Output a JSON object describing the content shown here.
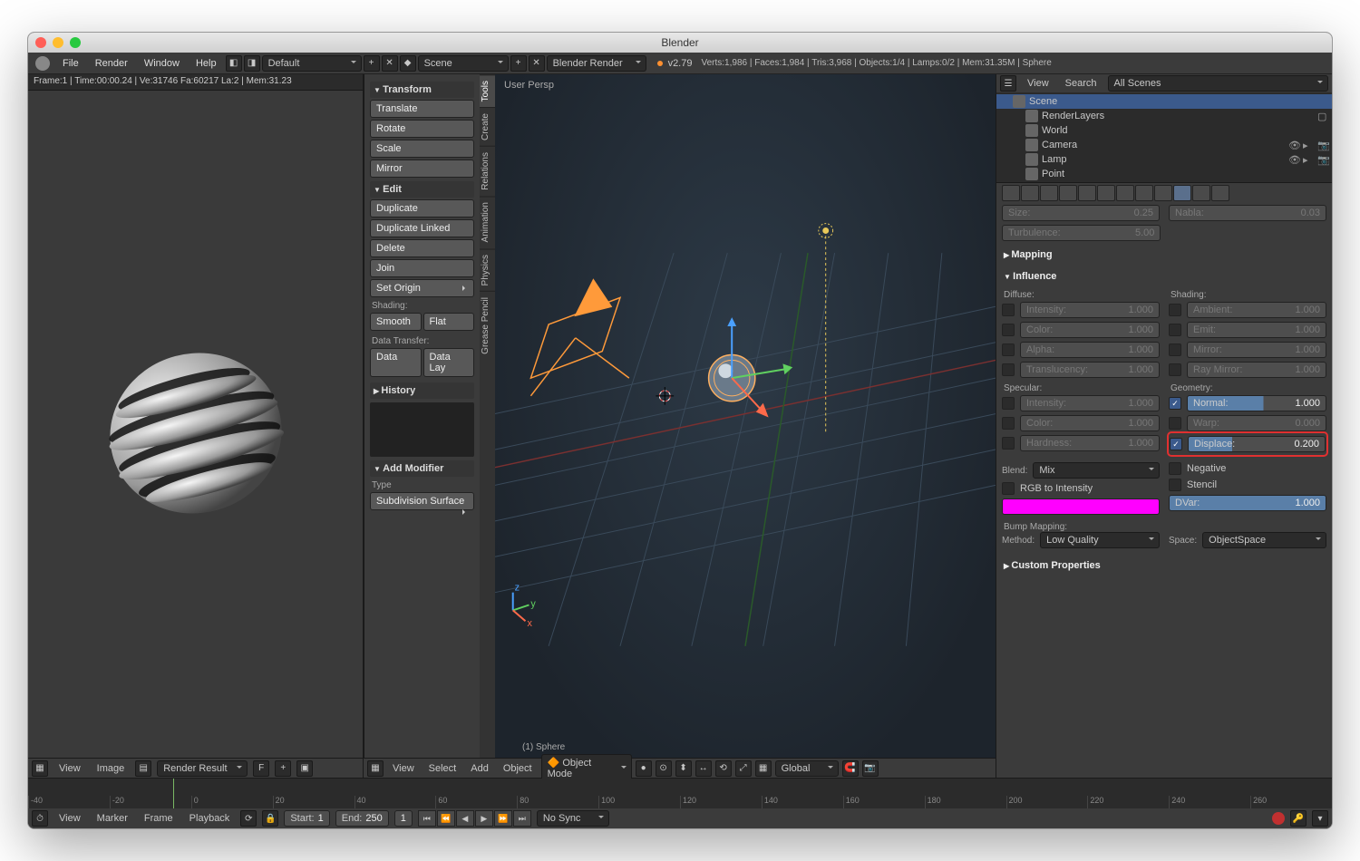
{
  "titlebar": {
    "title": "Blender"
  },
  "menubar": {
    "items": [
      "File",
      "Render",
      "Window",
      "Help"
    ],
    "layout": "Default",
    "scene": "Scene",
    "engine": "Blender Render",
    "version": "v2.79",
    "stats": "Verts:1,986 | Faces:1,984 | Tris:3,968 | Objects:1/4 | Lamps:0/2 | Mem:31.35M | Sphere"
  },
  "render": {
    "info": "Frame:1 | Time:00:00.24 | Ve:31746 Fa:60217 La:2 | Mem:31.23",
    "header": {
      "view": "View",
      "image": "Image",
      "slot": "Render Result",
      "letter": "F"
    }
  },
  "toolshelf": {
    "tabs": [
      "Tools",
      "Create",
      "Relations",
      "Animation",
      "Physics",
      "Grease Pencil"
    ],
    "transform": {
      "title": "Transform",
      "btns": [
        "Translate",
        "Rotate",
        "Scale",
        "Mirror"
      ]
    },
    "edit": {
      "title": "Edit",
      "btns": [
        "Duplicate",
        "Duplicate Linked",
        "Delete",
        "Join"
      ],
      "origin": "Set Origin"
    },
    "shading": {
      "label": "Shading:",
      "smooth": "Smooth",
      "flat": "Flat"
    },
    "datatransfer": {
      "label": "Data Transfer:",
      "data": "Data",
      "datalay": "Data Lay"
    },
    "history": "History",
    "addmod": {
      "title": "Add Modifier",
      "type_label": "Type",
      "type": "Subdivision Surface"
    }
  },
  "viewport": {
    "label": "User Persp",
    "object_label": "(1) Sphere",
    "header": {
      "view": "View",
      "select": "Select",
      "add": "Add",
      "object": "Object",
      "mode": "Object Mode",
      "orient": "Global"
    }
  },
  "outliner": {
    "header": {
      "view": "View",
      "search": "Search",
      "scope": "All Scenes"
    },
    "items": [
      "Scene",
      "RenderLayers",
      "World",
      "Camera",
      "Lamp",
      "Point"
    ]
  },
  "props": {
    "size": {
      "label": "Size:",
      "value": "0.25"
    },
    "nabla": {
      "label": "Nabla:",
      "value": "0.03"
    },
    "turb": {
      "label": "Turbulence:",
      "value": "5.00"
    },
    "mapping": "Mapping",
    "influence": "Influence",
    "diffuse": "Diffuse:",
    "shading": "Shading:",
    "specular": "Specular:",
    "geometry": "Geometry:",
    "diff_rows": [
      {
        "l": "Intensity:",
        "v": "1.000"
      },
      {
        "l": "Color:",
        "v": "1.000"
      },
      {
        "l": "Alpha:",
        "v": "1.000"
      },
      {
        "l": "Translucency:",
        "v": "1.000"
      }
    ],
    "shad_rows": [
      {
        "l": "Ambient:",
        "v": "1.000"
      },
      {
        "l": "Emit:",
        "v": "1.000"
      },
      {
        "l": "Mirror:",
        "v": "1.000"
      },
      {
        "l": "Ray Mirror:",
        "v": "1.000"
      }
    ],
    "spec_rows": [
      {
        "l": "Intensity:",
        "v": "1.000"
      },
      {
        "l": "Color:",
        "v": "1.000"
      },
      {
        "l": "Hardness:",
        "v": "1.000"
      }
    ],
    "geom_rows": [
      {
        "l": "Normal:",
        "v": "1.000",
        "on": true,
        "fill": 50
      },
      {
        "l": "Warp:",
        "v": "0.000",
        "on": false,
        "fill": 0
      },
      {
        "l": "Displace:",
        "v": "0.200",
        "on": true,
        "fill": 20,
        "hl": true
      }
    ],
    "blend": {
      "label": "Blend:",
      "value": "Mix"
    },
    "negative": "Negative",
    "stencil": "Stencil",
    "rgb": "RGB to Intensity",
    "dvar": {
      "label": "DVar:",
      "value": "1.000"
    },
    "bump": {
      "title": "Bump Mapping:",
      "method_l": "Method:",
      "method": "Low Quality",
      "space_l": "Space:",
      "space": "ObjectSpace"
    },
    "custom": "Custom Properties"
  },
  "timeline": {
    "menu": [
      "View",
      "Marker",
      "Frame",
      "Playback"
    ],
    "start": {
      "l": "Start:",
      "v": "1"
    },
    "end": {
      "l": "End:",
      "v": "250"
    },
    "cur": {
      "l": "",
      "v": "1"
    },
    "sync": "No Sync",
    "ticks": [
      "-40",
      "-20",
      "0",
      "20",
      "40",
      "60",
      "80",
      "100",
      "120",
      "140",
      "160",
      "180",
      "200",
      "220",
      "240",
      "260"
    ]
  }
}
